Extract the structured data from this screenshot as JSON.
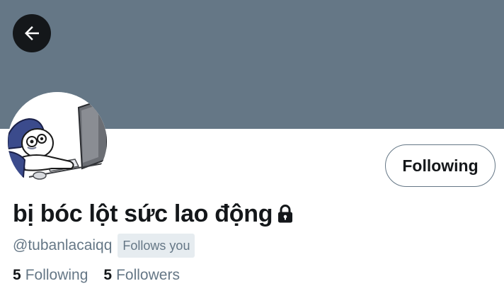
{
  "header": {
    "back_icon": "arrow-left-icon",
    "banner_color": "#657786"
  },
  "profile": {
    "display_name": "bị bóc lột sức lao động",
    "protected_icon": "lock-icon",
    "handle": "@tubanlacaiqq",
    "follows_you_label": "Follows you",
    "follow_button_label": "Following",
    "avatar": "cartoon-character-at-computer"
  },
  "stats": {
    "following_count": "5",
    "following_label": "Following",
    "followers_count": "5",
    "followers_label": "Followers"
  },
  "colors": {
    "text_primary": "#14171a",
    "text_secondary": "#657786",
    "badge_background": "#e6ecf0"
  }
}
